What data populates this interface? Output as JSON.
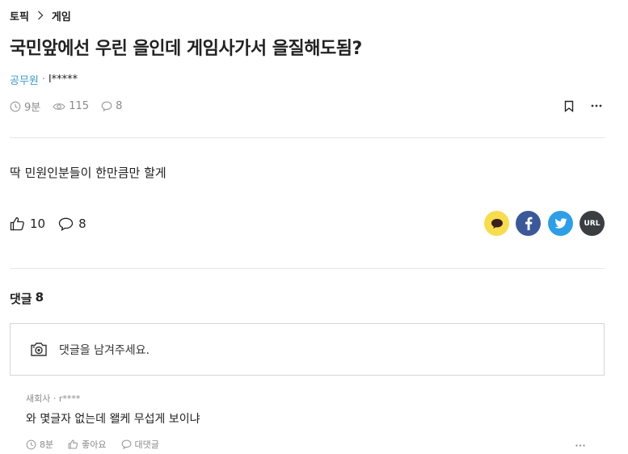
{
  "breadcrumb": {
    "topic": "토픽",
    "category": "게임"
  },
  "post": {
    "title": "국민앞에선 우린 을인데 게임사가서 을질해도됨?",
    "company": "공무원",
    "separator": "·",
    "nickname": "l*****",
    "time": "9분",
    "views": "115",
    "comments": "8",
    "body": "딱 민원인분들이 한만큼만 할게",
    "likes": "10",
    "comment_count": "8"
  },
  "share": {
    "url_label": "URL"
  },
  "comments_section": {
    "label": "댓글",
    "count": "8",
    "placeholder": "댓글을 남겨주세요."
  },
  "comments": [
    {
      "company": "새회사",
      "separator": "·",
      "nickname": "r****",
      "text": "와 몇글자 없는데 왤케 무섭게 보이냐",
      "time": "8분",
      "like_label": "좋아요",
      "reply_label": "대댓글"
    }
  ],
  "icons": {
    "breadcrumb_sep": "chevron-right-icon",
    "time": "clock-icon",
    "views": "eye-icon",
    "comments": "speech-bubble-icon",
    "bookmark": "bookmark-icon",
    "more": "more-horizontal-icon",
    "like": "thumbs-up-icon",
    "kakao": "kakao-talk-icon",
    "facebook": "facebook-icon",
    "twitter": "twitter-icon",
    "camera": "camera-icon"
  },
  "colors": {
    "company_link": "#3f9bc9",
    "kakao": "#f7dc4d",
    "facebook": "#3b5998",
    "twitter": "#2e9ee6",
    "url": "#3a3d42",
    "muted": "#8a8a8a"
  }
}
